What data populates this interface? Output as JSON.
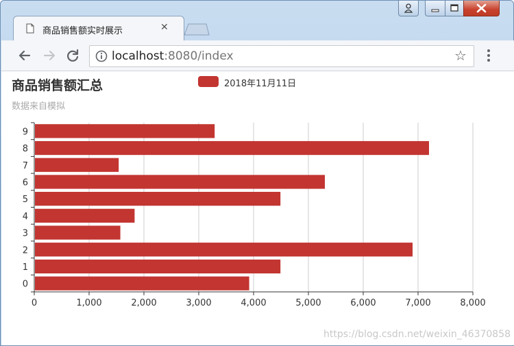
{
  "browser": {
    "tab_title": "商品销售额实时展示",
    "url_host": "localhost",
    "url_rest": ":8080/index"
  },
  "page": {
    "watermark": "https://blog.csdn.net/weixin_46370858"
  },
  "colors": {
    "bar": "#c23531",
    "grid": "#cccccc",
    "axis": "#333333"
  },
  "chart_data": {
    "type": "bar",
    "orientation": "horizontal",
    "title": "商品销售额汇总",
    "subtitle": "数据来自模拟",
    "categories": [
      "0",
      "1",
      "2",
      "3",
      "4",
      "5",
      "6",
      "7",
      "8",
      "9"
    ],
    "series": [
      {
        "name": "2018年11月11日",
        "values": [
          3920,
          4490,
          6900,
          1570,
          1830,
          4490,
          5300,
          1540,
          7200,
          3290
        ]
      }
    ],
    "xlim": [
      0,
      8000
    ],
    "x_ticks": [
      "0",
      "1,000",
      "2,000",
      "3,000",
      "4,000",
      "5,000",
      "6,000",
      "7,000",
      "8,000"
    ],
    "grid": true,
    "legend_position": "top"
  }
}
